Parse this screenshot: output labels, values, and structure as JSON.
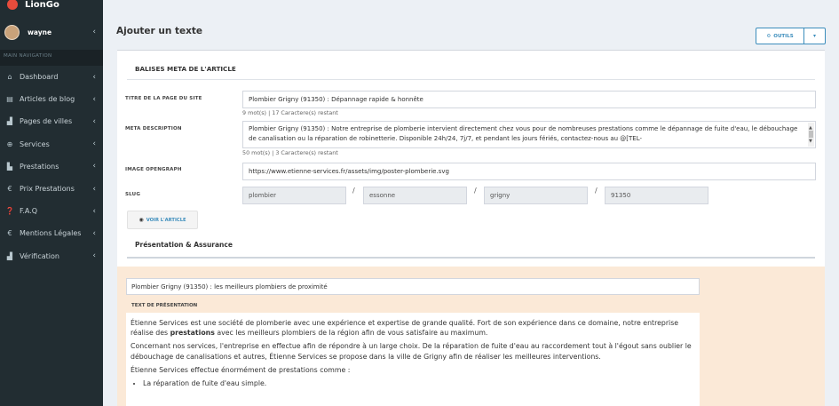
{
  "app": {
    "name": "LionGo"
  },
  "user": {
    "name": "wayne"
  },
  "sidebar": {
    "header": "MAIN NAVIGATION",
    "items": [
      {
        "label": "Dashboard",
        "icon": "home-icon"
      },
      {
        "label": "Articles de blog",
        "icon": "list-icon"
      },
      {
        "label": "Pages de villes",
        "icon": "chart-icon"
      },
      {
        "label": "Services",
        "icon": "globe-icon"
      },
      {
        "label": "Prestations",
        "icon": "building-icon"
      },
      {
        "label": "Prix Prestations",
        "icon": "euro-icon"
      },
      {
        "label": "F.A.Q",
        "icon": "question-icon"
      },
      {
        "label": "Mentions Légales",
        "icon": "euro-icon"
      },
      {
        "label": "Vérification",
        "icon": "chart-icon"
      }
    ]
  },
  "page": {
    "title": "Ajouter un texte",
    "tools_button": "OUTILS"
  },
  "meta_section": {
    "title": "BALISES META DE L'ARTICLE",
    "page_title_label": "TITRE DE LA PAGE DU SITE",
    "page_title_value": "Plombier Grigny (91350) :  Dépannage rapide & honnête",
    "page_title_hint": "9 mot(s) | 17 Caractere(s) restant",
    "meta_desc_label": "META DESCRIPTION",
    "meta_desc_value": "Plombier Grigny (91350) : Notre entreprise de plomberie intervient directement chez vous pour de nombreuses prestations comme le dépannage de fuite d'eau, le débouchage de canalisation ou la réparation de robinetterie. Disponible 24h/24, 7j/7, et pendant les jours fériés, contactez-nous au @[TEL-",
    "meta_desc_hint": "50 mot(s) | 3 Caractere(s) restant",
    "og_image_label": "IMAGE OPENGRAPH",
    "og_image_value": "https://www.etienne-services.fr/assets/img/poster-plomberie.svg",
    "slug_label": "SLUG",
    "slug_parts": [
      "plombier",
      "essonne",
      "grigny",
      "91350"
    ],
    "slug_sep": "/",
    "view_button": "VOIR L'ARTICLE"
  },
  "presentation": {
    "title": "Présentation & Assurance",
    "heading_value": "Plombier Grigny (91350) : les meilleurs plombiers de proximité",
    "text_label": "TEXT DE PRÉSENTATION",
    "p1_a": "Étienne Services est une société de plomberie avec une expérience et expertise de grande qualité. Fort de son expérience dans ce domaine, notre entreprise réalise des ",
    "p1_bold": "prestations",
    "p1_b": " avec les meilleurs plombiers de la région afin de vous satisfaire au maximum.",
    "p2": "Concernant nos services, l'entreprise en effectue afin de répondre à un large choix. De la réparation de fuite d'eau au raccordement tout à l'égout sans oublier le débouchage de canalisations et autres, Étienne Services se propose dans la ville de Grigny afin de réaliser les meilleures interventions.",
    "p3": "Étienne Services effectue énormément de prestations comme :",
    "li1": "La réparation de fuite d'eau simple."
  }
}
